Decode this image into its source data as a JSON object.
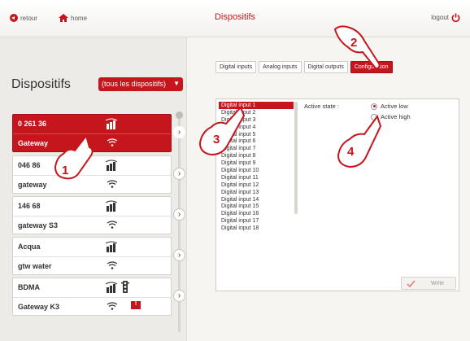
{
  "header": {
    "back_label": "retour",
    "home_label": "home",
    "title": "Dispositifs",
    "logout_label": "logout"
  },
  "sidebar": {
    "heading": "Dispositifs",
    "filter_value": "(tous les dispositifs)",
    "devices": [
      {
        "name": "0 261 36",
        "sub": "Gateway",
        "selected": true
      },
      {
        "name": "046 86",
        "sub": "gateway",
        "selected": false
      },
      {
        "name": "146 68",
        "sub": "gateway S3",
        "selected": false
      },
      {
        "name": "Acqua",
        "sub": "gtw water",
        "selected": false
      },
      {
        "name": "BDMA",
        "sub": "Gateway K3",
        "selected": false,
        "alert_label": "!"
      }
    ]
  },
  "tabs": [
    "Digital inputs",
    "Analog inputs",
    "Digital outputs",
    "Configuration"
  ],
  "active_tab": "Configuration",
  "inputs": [
    "Digital input 1",
    "Digital input 2",
    "Digital input 3",
    "Digital input 4",
    "Digital input 5",
    "Digital input 6",
    "Digital input 7",
    "Digital input 8",
    "Digital input 9",
    "Digital input 10",
    "Digital input 11",
    "Digital input 12",
    "Digital input 13",
    "Digital input 14",
    "Digital input 15",
    "Digital input 16",
    "Digital input 17",
    "Digital input 18"
  ],
  "selected_input": "Digital input 1",
  "config": {
    "active_state_label": "Active state :",
    "options": [
      "Active low",
      "Active high"
    ],
    "selected_option": "Active low",
    "write_label": "Write"
  },
  "callouts": [
    "1",
    "2",
    "3",
    "4"
  ],
  "colors": {
    "accent": "#c6161d"
  }
}
